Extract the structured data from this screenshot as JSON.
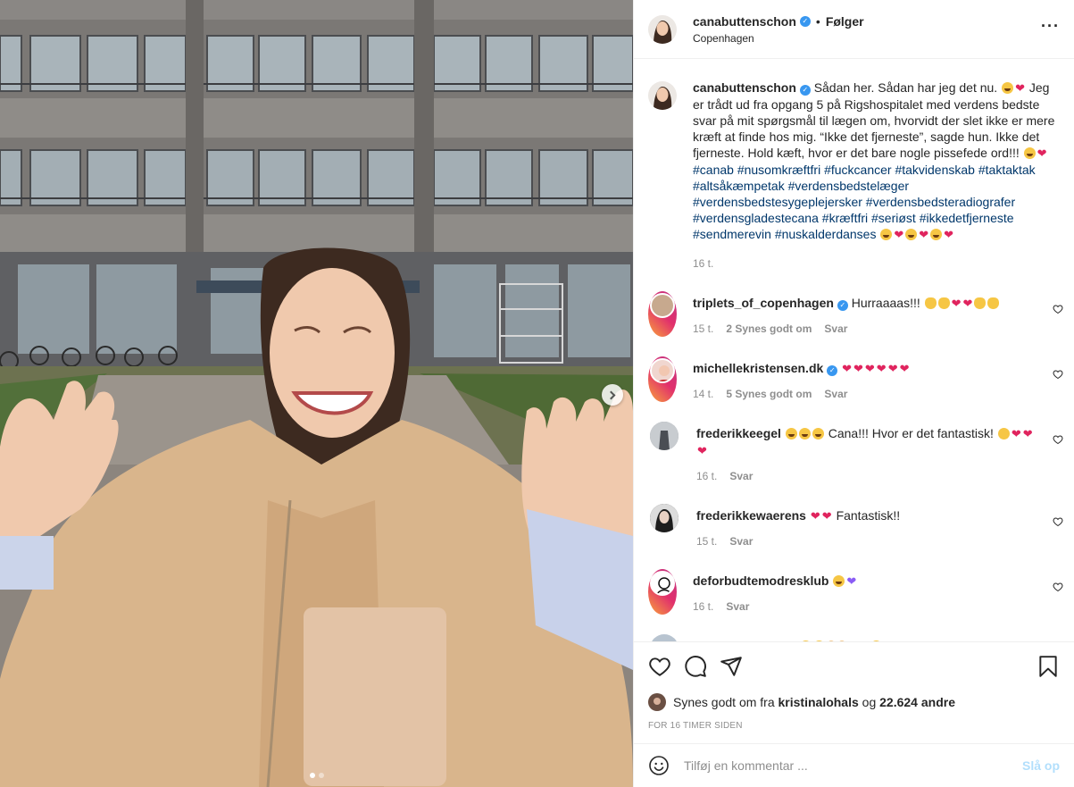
{
  "post": {
    "author": "canabuttenschon",
    "follow_status": "Følger",
    "location": "Copenhagen",
    "more_icon": "more-options-icon"
  },
  "caption": {
    "author": "canabuttenschon",
    "text": "Sådan her. Sådan har jeg det nu.",
    "text2": "Jeg er trådt ud fra opgang 5 på Rigshospitalet med verdens bedste svar på mit spørgsmål til lægen om, hvorvidt der slet ikke er mere kræft at finde hos mig. “Ikke det fjerneste”, sagde hun. Ikke det fjerneste. Hold kæft, hvor er det bare nogle pissefede ord!!!",
    "hashtags": [
      "#canab",
      "#nusomkræftfri",
      "#fuckcancer",
      "#takvidenskab",
      "#taktaktak",
      "#altsåkæmpetak",
      "#verdensbedstelæger",
      "#verdensbedstesygeplejersker",
      "#verdensbedsteradiografer",
      "#verdensgladestecana",
      "#kræftfri",
      "#seriøst",
      "#ikkedetfjerneste",
      "#sendmerevin",
      "#nuskalderdanses"
    ],
    "time": "16 t."
  },
  "comments": [
    {
      "user": "triplets_of_copenhagen",
      "verified": true,
      "text": "Hurraaaas!!!",
      "time": "15 t.",
      "likes": "2 Synes godt om",
      "reply": "Svar"
    },
    {
      "user": "michellekristensen.dk",
      "verified": true,
      "text": "",
      "time": "14 t.",
      "likes": "5 Synes godt om",
      "reply": "Svar"
    },
    {
      "user": "frederikkeegel",
      "verified": false,
      "text": "Cana!!! Hvor er det fantastisk!",
      "time": "16 t.",
      "likes": "",
      "reply": "Svar"
    },
    {
      "user": "frederikkewaerens",
      "verified": false,
      "text": "Fantastisk!!",
      "time": "15 t.",
      "likes": "",
      "reply": "Svar"
    },
    {
      "user": "deforbudtemodresklub",
      "verified": false,
      "text": "",
      "time": "16 t.",
      "likes": "",
      "reply": "Svar"
    },
    {
      "user": "annebertram",
      "verified": false,
      "text": "",
      "time": "",
      "likes": "",
      "reply": ""
    }
  ],
  "actions": {
    "like_icon": "heart-icon",
    "comment_icon": "comment-icon",
    "share_icon": "paper-plane-icon",
    "save_icon": "bookmark-icon"
  },
  "likes": {
    "prefix": "Synes godt om fra",
    "user": "kristinalohals",
    "joiner": "og",
    "others": "22.624 andre"
  },
  "posted_ago": "FOR 16 TIMER SIDEN",
  "add_comment": {
    "placeholder": "Tilføj en kommentar ...",
    "post_label": "Slå op"
  },
  "colors": {
    "link": "#00376b",
    "verified": "#3897f0",
    "muted": "#8e8e8e",
    "post_disabled": "#b2dffc"
  }
}
